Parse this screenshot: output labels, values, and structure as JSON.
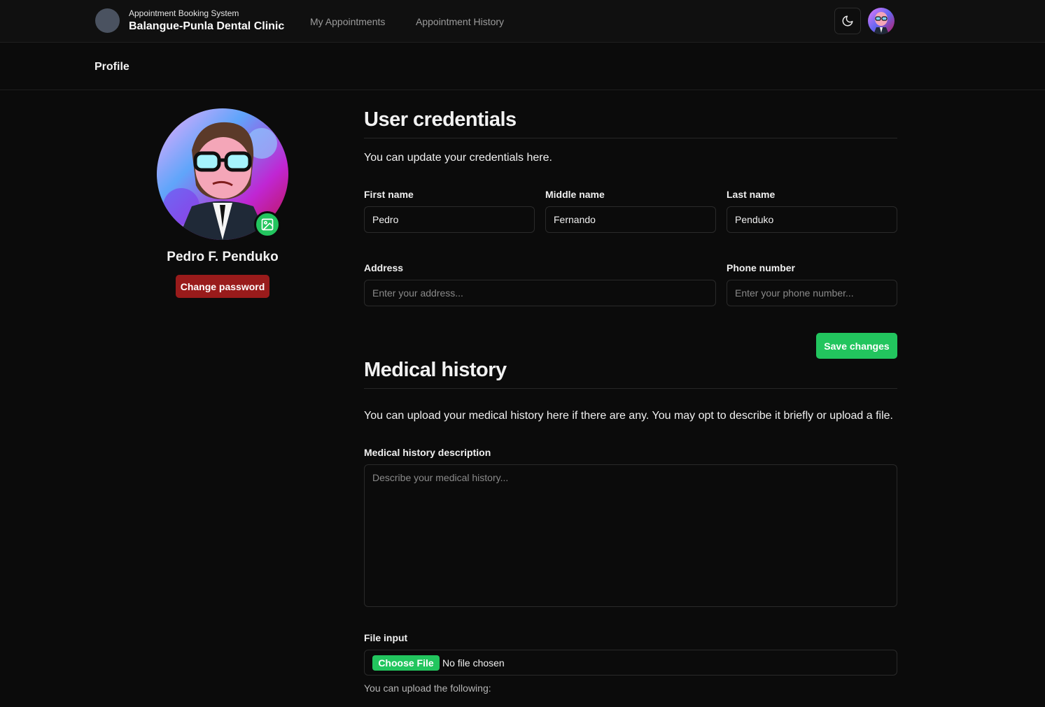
{
  "header": {
    "system_name": "Appointment Booking System",
    "clinic_name": "Balangue-Punla Dental Clinic",
    "nav": [
      {
        "label": "My Appointments"
      },
      {
        "label": "Appointment History"
      }
    ],
    "theme_icon": "moon-icon",
    "avatar_icon": "user-avatar"
  },
  "page": {
    "title": "Profile"
  },
  "profile": {
    "name": "Pedro F. Penduko",
    "change_password_label": "Change password",
    "upload_icon": "image-icon"
  },
  "credentials": {
    "heading": "User credentials",
    "description": "You can update your credentials here.",
    "first_name": {
      "label": "First name",
      "value": "Pedro"
    },
    "middle_name": {
      "label": "Middle name",
      "value": "Fernando"
    },
    "last_name": {
      "label": "Last name",
      "value": "Penduko"
    },
    "address": {
      "label": "Address",
      "value": "",
      "placeholder": "Enter your address..."
    },
    "phone": {
      "label": "Phone number",
      "value": "",
      "placeholder": "Enter your phone number..."
    },
    "save_label": "Save changes"
  },
  "medical": {
    "heading": "Medical history",
    "description": "You can upload your medical history here if there are any. You may opt to describe it briefly or upload a file.",
    "description_field": {
      "label": "Medical history description",
      "placeholder": "Describe your medical history..."
    },
    "file": {
      "label": "File input",
      "button_label": "Choose File",
      "status": "No file chosen",
      "hint": "You can upload the following:"
    }
  },
  "colors": {
    "accent_green": "#22c55e",
    "danger_red": "#991b1b",
    "background": "#0b0b0b"
  }
}
